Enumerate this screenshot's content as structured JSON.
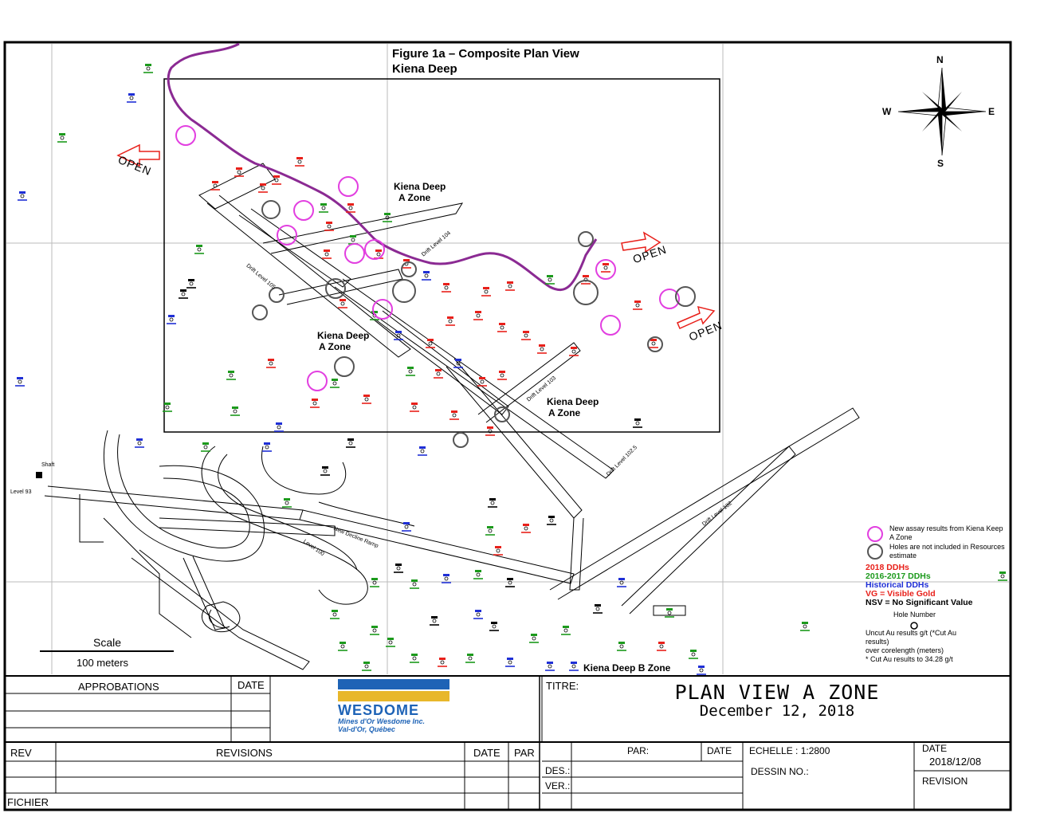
{
  "figure": {
    "title_line1": "Figure 1a – Composite Plan View",
    "title_line2": "Kiena Deep"
  },
  "compass": {
    "north": "N",
    "south": "S",
    "east": "E",
    "west": "W"
  },
  "zone_labels": [
    {
      "line1": "Kiena Deep",
      "line2": "A Zone"
    },
    {
      "line1": "Kiena Deep",
      "line2": "A Zone"
    },
    {
      "line1": "Kiena Deep",
      "line2": "A Zone"
    },
    {
      "line1": "Kiena Deep B Zone",
      "line2": ""
    }
  ],
  "open_labels": [
    "OPEN",
    "OPEN",
    "OPEN"
  ],
  "map_labels": {
    "shaft": "Shaft",
    "level93": "Level 93",
    "level100": "Level 100",
    "drift105": "Drift Level 105",
    "drift104": "Drift Level 104",
    "drift103": "Drift Level 103",
    "drift1025": "Drift Level 102.5",
    "drift102": "Drift Level 102",
    "ramp": "New Decline Ramp"
  },
  "legend": {
    "new_assay": "New assay results from Kiena Keep A Zone",
    "not_included": "Holes are not included in Resources estimate",
    "ddh_2018": "2018 DDHs",
    "ddh_2016_2017": "2016-2017 DDHs",
    "historical": "Historical DDHs",
    "vg": "VG = Visible Gold",
    "nsv": "NSV = No Significant Value",
    "hole_number": "Hole Number",
    "uncut": "Uncut Au results g/t (*Cut Au results)",
    "over_core": "over corelength (meters)",
    "cut_note": "* Cut Au results to 34.28 g/t",
    "colors": {
      "red": "#e8201a",
      "green": "#1c9a1c",
      "blue": "#1f2fd6",
      "magenta": "#e23fe0",
      "purple": "#8b2a93"
    }
  },
  "scale": {
    "title": "Scale",
    "distance": "100 meters"
  },
  "title_block": {
    "approbations": "APPROBATIONS",
    "date_header": "DATE",
    "company_name": "WESDOME",
    "company_line1": "Mines d'Or Wesdome Inc.",
    "company_line2": "Val-d'Or, Québec",
    "titre": "TITRE:",
    "plan_title": "PLAN VIEW A ZONE",
    "plan_date": "December 12, 2018",
    "rev": "REV",
    "revisions": "REVISIONS",
    "rev_date": "DATE",
    "par": "PAR",
    "fichier": "FICHIER",
    "par_label": "PAR:",
    "date_label": "DATE",
    "echelle": "ECHELLE :  1:2800",
    "dessin": "DESSIN NO.:",
    "date_title": "DATE",
    "date_value": "2018/12/08",
    "revision": "REVISION",
    "des": "DES.:",
    "ver": "VER.:"
  }
}
